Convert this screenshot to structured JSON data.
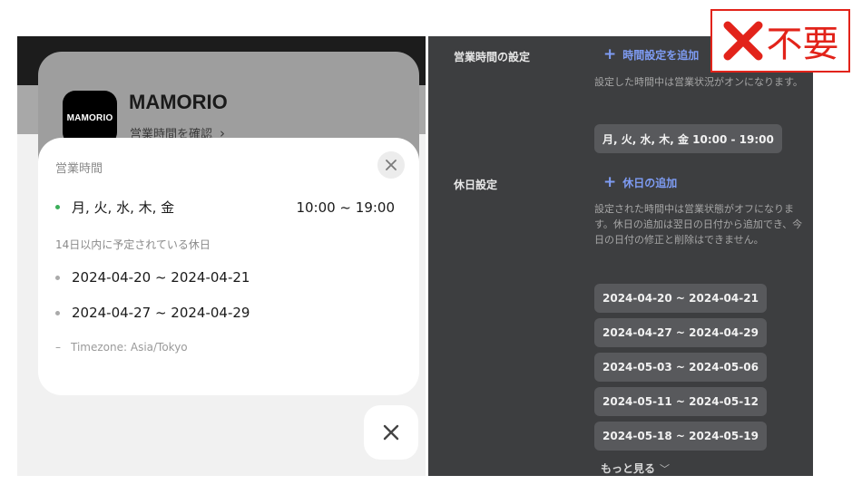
{
  "left": {
    "app_name": "MAMORIO",
    "logo_text": "MAMORIO",
    "hours_link_label": "営業時間を確認",
    "card": {
      "title": "営業時間",
      "hours": {
        "days": "月, 火, 水, 木, 金",
        "time": "10:00 ~ 19:00"
      },
      "holiday_heading": "14日以内に予定されている休日",
      "holidays": [
        "2024-04-20 ~ 2024-04-21",
        "2024-04-27 ~ 2024-04-29"
      ],
      "timezone": "Timezone: Asia/Tokyo"
    }
  },
  "right": {
    "business_hours": {
      "label": "営業時間の設定",
      "add_label": "時間設定を追加",
      "description": "設定した時間中は営業状況がオンになります。",
      "schedule": "月, 火, 水, 木, 金 10:00 - 19:00"
    },
    "holiday": {
      "label": "休日設定",
      "add_label": "休日の追加",
      "description": "設定された時間中は営業状態がオフになります。休日の追加は翌日の日付から追加でき、今日の日付の修正と削除はできません。",
      "dates": [
        "2024-04-20 ~ 2024-04-21",
        "2024-04-27 ~ 2024-04-29",
        "2024-05-03 ~ 2024-05-06",
        "2024-05-11 ~ 2024-05-12",
        "2024-05-18 ~ 2024-05-19"
      ],
      "more_label": "もっと見る"
    }
  },
  "stamp": {
    "text": "不要",
    "color": "#e2231a"
  },
  "icons": {
    "close": "close-icon",
    "chevron_right": "chevron-right-icon",
    "chevron_down": "chevron-down-icon",
    "plus": "plus-icon",
    "status_dot": "status-dot-icon",
    "cross_mark": "cross-mark-icon"
  },
  "colors": {
    "accent_blue": "#7e9cf4",
    "status_green": "#3cae5a",
    "dark_panel": "#3d3e40",
    "pill": "#58595c"
  }
}
